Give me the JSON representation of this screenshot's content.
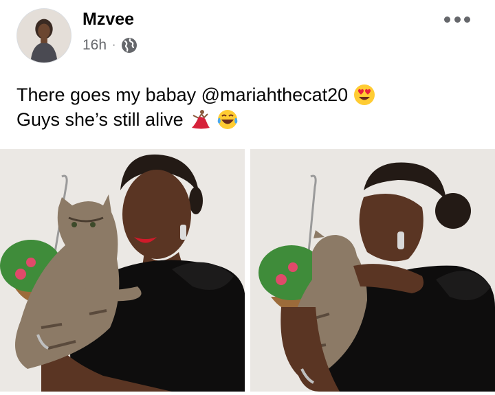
{
  "post": {
    "author": "Mzvee",
    "time": "16h",
    "separator": "·",
    "audience_icon": "globe-icon",
    "more_icon": "more-horizontal-icon",
    "text_line1": "There goes my babay @mariahthecat20",
    "text_line1_emoji": "heart-eyes-emoji",
    "text_line2": "Guys she’s still alive",
    "text_line2_emojis": [
      "dancer-emoji",
      "tears-of-joy-emoji"
    ]
  },
  "photos": [
    {
      "name": "photo-woman-smiling-with-cat"
    },
    {
      "name": "photo-woman-kissing-cat"
    }
  ],
  "colors": {
    "text_primary": "#050505",
    "text_secondary": "#65676b",
    "background": "#ffffff"
  }
}
